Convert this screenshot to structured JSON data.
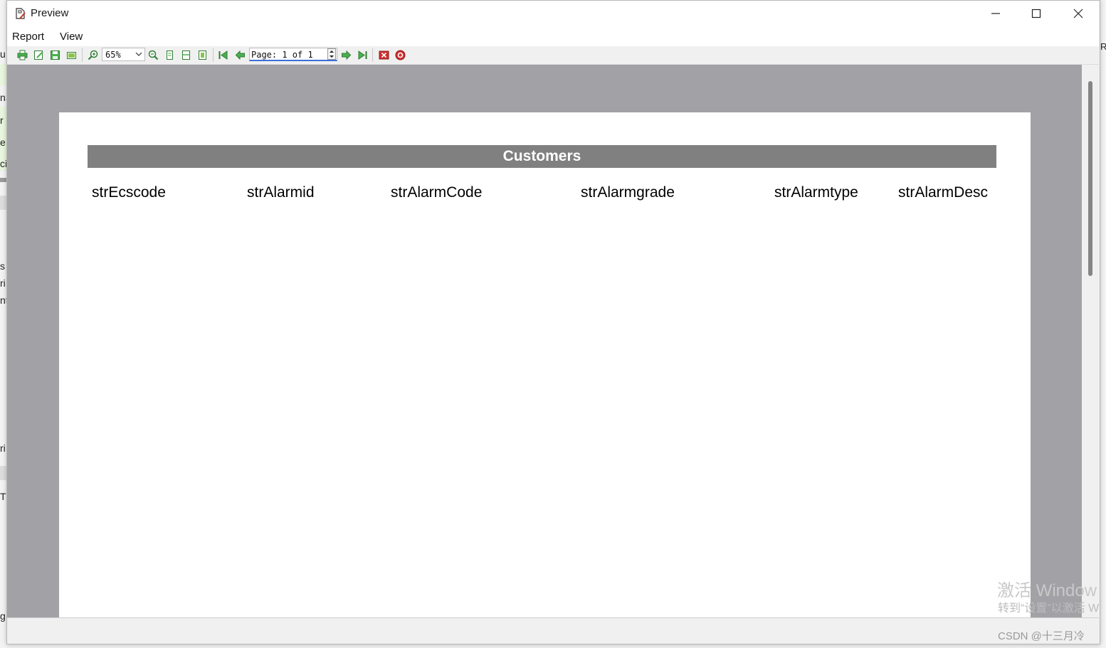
{
  "window": {
    "title": "Preview",
    "controls": {
      "minimize": "minimize-icon",
      "maximize": "maximize-icon",
      "close": "close-icon"
    }
  },
  "menu": [
    "Report",
    "View"
  ],
  "toolbar": {
    "zoom": "65%",
    "page_text": "Page: 1 of 1",
    "icons": [
      "print-icon",
      "edit-icon",
      "save-icon",
      "export-icon",
      "zoom-in-icon",
      "zoom-out-icon",
      "one-page-icon",
      "page-width-icon",
      "full-page-icon",
      "first-page-icon",
      "prev-page-icon",
      "next-page-icon",
      "last-page-icon",
      "close-preview-icon",
      "help-icon"
    ]
  },
  "report": {
    "title": "Customers",
    "columns": [
      "strEcscode",
      "strAlarmid",
      "strAlarmCode",
      "strAlarmgrade",
      "strAlarmtype",
      "strAlarmDesc"
    ]
  },
  "watermark": {
    "line1": "激活 Window",
    "line2": "转到“设置”以激活 W",
    "csdn": "CSDN @十三月冷"
  },
  "background_fragments": {
    "left": [
      "u",
      "nS",
      "r",
      "e",
      "ci",
      "s",
      "ri",
      "nt",
      "ri",
      "T",
      "g"
    ],
    "right": [
      "R"
    ]
  }
}
